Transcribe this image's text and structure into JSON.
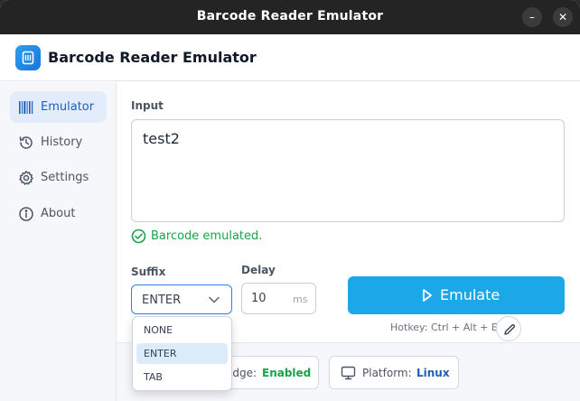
{
  "window": {
    "title": "Barcode Reader Emulator",
    "minimize_glyph": "–",
    "close_glyph": "✕"
  },
  "header": {
    "title": "Barcode Reader Emulator",
    "logo_icon": "barcode-scanner-icon"
  },
  "sidebar": {
    "items": [
      {
        "label": "Emulator",
        "icon": "barcode-icon",
        "active": true
      },
      {
        "label": "History",
        "icon": "history-icon",
        "active": false
      },
      {
        "label": "Settings",
        "icon": "gear-icon",
        "active": false
      },
      {
        "label": "About",
        "icon": "info-icon",
        "active": false
      }
    ]
  },
  "input": {
    "label": "Input",
    "value": "test2"
  },
  "status": {
    "text": "Barcode emulated.",
    "icon": "check-circle-icon",
    "color": "#16a34a"
  },
  "suffix": {
    "label": "Suffix",
    "value": "ENTER",
    "options": [
      "NONE",
      "ENTER",
      "TAB"
    ]
  },
  "delay": {
    "label": "Delay",
    "value": "10",
    "unit": "ms"
  },
  "emulate": {
    "label": "Emulate",
    "icon": "play-icon",
    "color": "#1ba7e8"
  },
  "hotkey": {
    "text": "Hotkey: Ctrl + Alt + E",
    "edit_icon": "pencil-icon"
  },
  "footer": {
    "badge": {
      "key": "dge:",
      "value": "Enabled",
      "color": "#16a34a"
    },
    "platform": {
      "key": "Platform:",
      "value": "Linux",
      "icon": "monitor-icon",
      "color": "#1e5fb8"
    }
  }
}
